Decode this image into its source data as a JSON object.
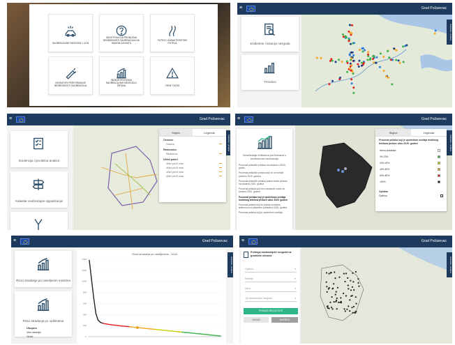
{
  "app": {
    "city": "Grad Požarevac",
    "side_tab": "Statistike i analiza"
  },
  "panel1": {
    "tiles": [
      {
        "label": "SAOBRAĆAJNE NEZGODE 1-4/18",
        "icon": "car-crash-icon"
      },
      {
        "label": "IDENTIFIKACIJA PROBLEMA BEZBEDNOSTI SAOBRAĆAJA NA SAMOM ZAHVATU",
        "icon": "question-icon"
      },
      {
        "label": "PUTEVI I KARAKTERISTIKE PUTEVA",
        "icon": "road-icon"
      },
      {
        "label": "INDIKATORI PERFORMANSI BEZBEDNOSTI SAOBRAĆAJA",
        "icon": "syringe-icon"
      },
      {
        "label": "INDIKATORI RIZIKA SAOBRAĆAJNIH NEZGODA I ŽRTAVA",
        "icon": "chart-up-icon"
      },
      {
        "label": "CRNE TAČKE",
        "icon": "warning-icon"
      }
    ]
  },
  "panel2": {
    "cards": [
      {
        "label": "Evidentne i lokacije nezgoda",
        "icon": "document-search-icon"
      },
      {
        "label": "Trendovi",
        "icon": "bar-chart-icon"
      }
    ]
  },
  "panel3": {
    "cards": [
      {
        "label": "Evidencija i prvobitna analiza",
        "icon": "checklist-icon"
      },
      {
        "label": "Katastar saobraćajne signalizacije",
        "icon": "signpost-icon"
      },
      {
        "label": "",
        "icon": "road-fork-icon"
      }
    ],
    "legend": {
      "tabs": [
        "Slojevi",
        "Legenda"
      ],
      "groups": [
        {
          "title": "Osnovni",
          "items": [
            "Granica"
          ]
        },
        {
          "title": "Raskrsnice",
          "items": [
            "Raskrsnica"
          ]
        },
        {
          "title": "Ulični poteri",
          "items": [
            "Ulični put III reda",
            "Ulični put III reda",
            "Ulični put III reda",
            "Ulični put III reda"
          ]
        }
      ]
    }
  },
  "panel4": {
    "card_title": "Vizuelizacija indikatora performansi u bezbednosti saobraćaja",
    "list": [
      "Procenat pešačkih prelaza na ulicama u 2020. godini",
      "Procenat pešačkih prelaza koji se ne koriste pravilno 2020. godina",
      "Procenat pešačkih prelaza prema brzini pešaka na ulicama 2020. godina",
      "Procenat pešaka koji nisu zaustavili vozilo za prelaza 2020. godina",
      "Procenat pešaka koji je upotrebom uređaja mobilnog telefona prelaze ulicu 2020. godine",
      "Procenat pešaka koji se koriste mobilnim telefonom na pešačkim prelazima 2020. godina",
      "Procenat pešaka koji je upotrebom uređaja"
    ],
    "legend": {
      "tabs": [
        "Slojevi",
        "Legenda"
      ],
      "title": "Procenat pešaka koji je upotrebom uređaja mobilnog telefona prelaze ulicu 2020. godine",
      "items": [
        {
          "label": "Nema podataka",
          "color": "#ffffff"
        },
        {
          "label": "0%-20%",
          "color": "#3cb44b"
        },
        {
          "label": "20%-40%",
          "color": "#c8d400"
        },
        {
          "label": "40%-60%",
          "color": "#f5a623"
        },
        {
          "label": "60%-80%",
          "color": "#e02020"
        },
        {
          "label": ">80%",
          "color": "#111111"
        }
      ],
      "extra_title": "Opština",
      "extra_item": "Opština"
    }
  },
  "panel5": {
    "cards": [
      {
        "label": "Rizici stradanja po naseljenim mestima",
        "icon": "chart-up-icon"
      },
      {
        "label": "Rizici stradanja po opštinama",
        "icon": "chart-up-icon"
      }
    ],
    "sublist": [
      "Ukupno",
      "Van naselja",
      "Grad"
    ],
    "chart_data": {
      "type": "line",
      "title": "Rizici stradanja po naseljenima - 2018.",
      "ylim": [
        0,
        1400
      ],
      "yticks": [
        0,
        200,
        400,
        600,
        800,
        1000,
        1200,
        1400
      ],
      "values": [
        1380,
        1040,
        700,
        420,
        300,
        260,
        245,
        235,
        228,
        222,
        216,
        210,
        205,
        200,
        196,
        192,
        188,
        184,
        180,
        176,
        172,
        168,
        164,
        160,
        156,
        152,
        148,
        144,
        140,
        136,
        132,
        128,
        124,
        120,
        116,
        112,
        108,
        104,
        100,
        96,
        92,
        88,
        84,
        80,
        76,
        72,
        68,
        64,
        60,
        56,
        52,
        48,
        44,
        40,
        36,
        32,
        28,
        24,
        20,
        16,
        12
      ],
      "segment_colors": [
        "#222222",
        "#e02020",
        "#f5a623",
        "#c8d400",
        "#3cb44b"
      ],
      "highlight_index": 22
    }
  },
  "panel6": {
    "title": "Pretraga saobraćajnih nezgoda na gradskim ulicama",
    "fields": [
      "Opština",
      "Naselje",
      "Ulica",
      "Tip saobraćajne nezgode"
    ],
    "search_button": "PRIKAŽI REZULTATE",
    "nav_buttons": [
      "NAZAD",
      "NAPRED"
    ]
  }
}
